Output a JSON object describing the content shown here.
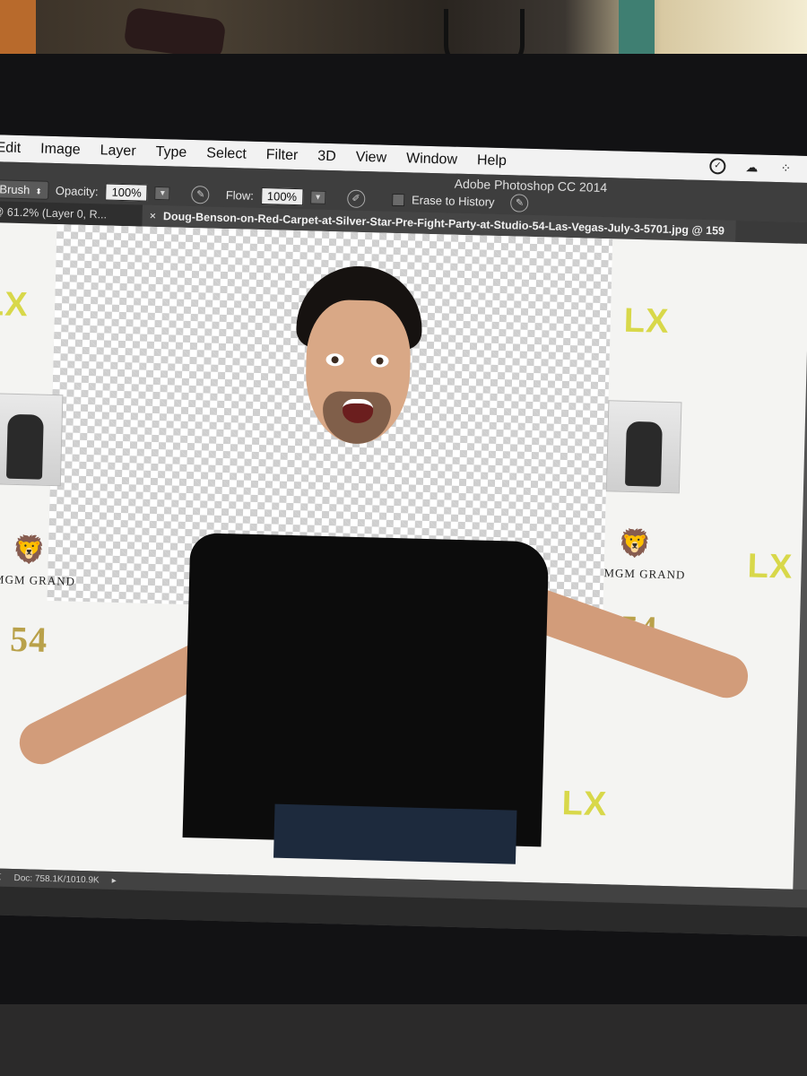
{
  "menubar": {
    "items": [
      "Edit",
      "Image",
      "Layer",
      "Type",
      "Select",
      "Filter",
      "3D",
      "View",
      "Window",
      "Help"
    ],
    "status_icons": [
      "check-circle-icon",
      "creative-cloud-icon",
      "dropbox-icon"
    ]
  },
  "app_title": "Adobe Photoshop CC 2014",
  "options": {
    "tool_preset": "Brush",
    "opacity_label": "Opacity:",
    "opacity_value": "100%",
    "flow_label": "Flow:",
    "flow_value": "100%",
    "erase_to_history_label": "Erase to History"
  },
  "tabs": [
    {
      "label": "@ 61.2% (Layer 0, R..."
    },
    {
      "label": "Doug-Benson-on-Red-Carpet-at-Silver-Star-Pre-Fight-Party-at-Studio-54-Las-Vegas-July-3-5701.jpg @ 159"
    }
  ],
  "canvas": {
    "backdrop_logos": {
      "mgm": "MGM GRAND",
      "lx": "LX",
      "studio54": "54"
    }
  },
  "status": {
    "zoom": "%",
    "doc": "Doc: 758.1K/1010.9K"
  }
}
